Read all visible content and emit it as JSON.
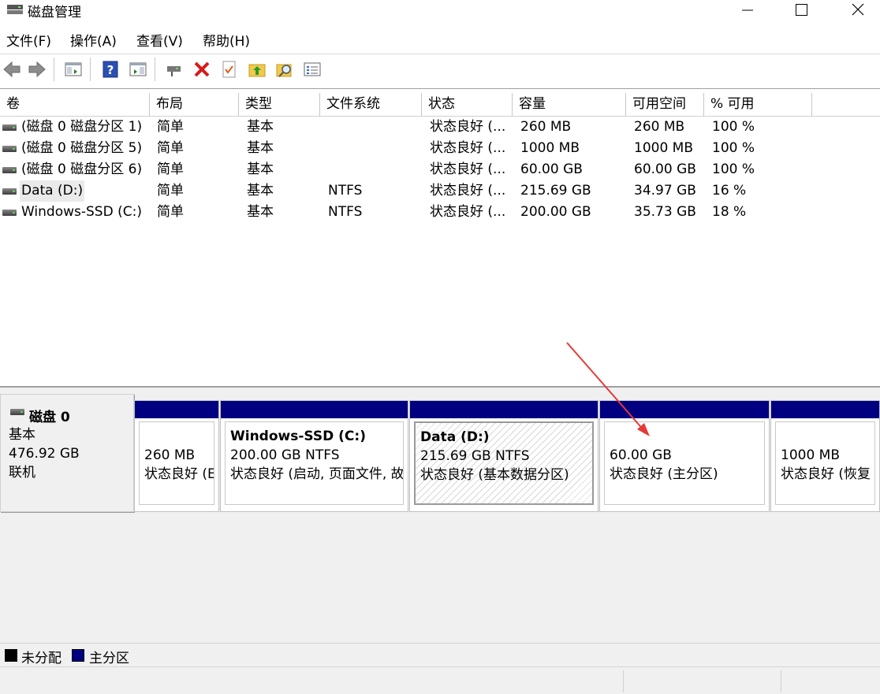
{
  "window": {
    "title": "磁盘管理",
    "controls": {
      "minimize": "—",
      "maximize": "☐",
      "close": "✕"
    }
  },
  "menu": [
    "文件(F)",
    "操作(A)",
    "查看(V)",
    "帮助(H)"
  ],
  "toolbar": [
    "back-icon",
    "forward-icon",
    "show-hide-console-tree-icon",
    "help-icon",
    "properties-icon",
    "connect-drive-icon",
    "delete-icon",
    "check-icon",
    "up-folder-icon",
    "search-icon",
    "list-icon"
  ],
  "columns": [
    "卷",
    "布局",
    "类型",
    "文件系统",
    "状态",
    "容量",
    "可用空间",
    "% 可用"
  ],
  "volumes": [
    {
      "name": "(磁盘 0 磁盘分区 1)",
      "layout": "简单",
      "type": "基本",
      "fs": "",
      "status": "状态良好 (...",
      "capacity": "260 MB",
      "free": "260 MB",
      "pct": "100 %"
    },
    {
      "name": "(磁盘 0 磁盘分区 5)",
      "layout": "简单",
      "type": "基本",
      "fs": "",
      "status": "状态良好 (...",
      "capacity": "1000 MB",
      "free": "1000 MB",
      "pct": "100 %"
    },
    {
      "name": "(磁盘 0 磁盘分区 6)",
      "layout": "简单",
      "type": "基本",
      "fs": "",
      "status": "状态良好 (...",
      "capacity": "60.00 GB",
      "free": "60.00 GB",
      "pct": "100 %"
    },
    {
      "name": "Data (D:)",
      "layout": "简单",
      "type": "基本",
      "fs": "NTFS",
      "status": "状态良好 (...",
      "capacity": "215.69 GB",
      "free": "34.97 GB",
      "pct": "16 %"
    },
    {
      "name": "Windows-SSD (C:)",
      "layout": "简单",
      "type": "基本",
      "fs": "NTFS",
      "status": "状态良好 (...",
      "capacity": "200.00 GB",
      "free": "35.73 GB",
      "pct": "18 %"
    }
  ],
  "disk": {
    "name": "磁盘 0",
    "type": "基本",
    "size": "476.92 GB",
    "state": "联机",
    "partitions": [
      {
        "title": "",
        "size": "260 MB",
        "status": "状态良好 (E"
      },
      {
        "title": "Windows-SSD  (C:)",
        "size": "200.00 GB NTFS",
        "status": "状态良好 (启动, 页面文件, 故"
      },
      {
        "title": "Data  (D:)",
        "size": "215.69 GB NTFS",
        "status": "状态良好 (基本数据分区)"
      },
      {
        "title": "",
        "size": "60.00 GB",
        "status": "状态良好 (主分区)"
      },
      {
        "title": "",
        "size": "1000 MB",
        "status": "状态良好 (恢复"
      }
    ]
  },
  "legend": [
    {
      "label": "未分配",
      "color": "#000000"
    },
    {
      "label": "主分区",
      "color": "#000080"
    }
  ],
  "colors": {
    "primary_partition": "#000080",
    "annotation_arrow": "#e53935"
  }
}
